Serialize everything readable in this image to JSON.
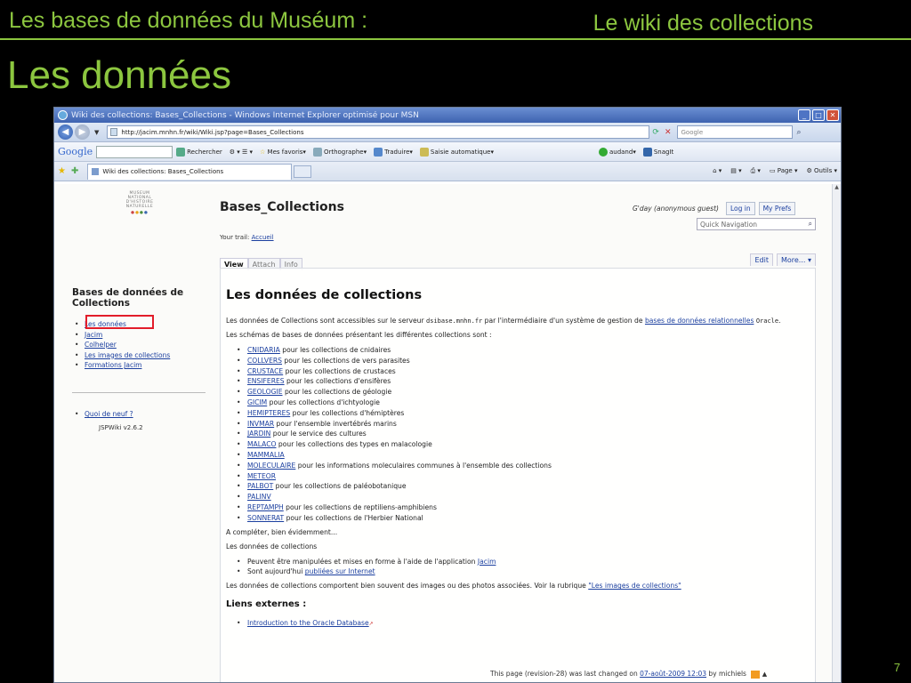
{
  "slide": {
    "header_left": "Les bases de données du Muséum :",
    "header_right": "Le wiki des collections",
    "title": "Les données",
    "page_number": "7"
  },
  "browser": {
    "window_title": "Wiki des collections: Bases_Collections - Windows Internet Explorer optimisé pour MSN",
    "url": "http://jacim.mnhn.fr/wiki/Wiki.jsp?page=Bases_Collections",
    "search_placeholder": "Google",
    "google_toolbar": {
      "logo": "Google",
      "search_btn": "Rechercher",
      "favorites": "Mes favoris",
      "spelling": "Orthographe",
      "translate": "Traduire",
      "autofill": "Saisie automatique",
      "user": "audand",
      "snagit": "SnagIt"
    },
    "tab_label": "Wiki des collections: Bases_Collections",
    "tab_tools": {
      "page": "Page",
      "tools": "Outils"
    }
  },
  "wiki": {
    "logo_lines": [
      "MUSEUM",
      "NATIONAL",
      "D'HISTOIRE",
      "NATURELLE"
    ],
    "page_name": "Bases_Collections",
    "trail_label": "Your trail:",
    "trail_link": "Accueil",
    "user_greeting": "G'day (anonymous guest)",
    "login": "Log in",
    "prefs": "My Prefs",
    "quick_nav": "Quick Navigation",
    "tabs": {
      "view": "View",
      "attach": "Attach",
      "info": "Info",
      "edit": "Edit",
      "more": "More... ▾"
    },
    "sidebar": {
      "title": "Bases de données de Collections",
      "links": [
        "Les données",
        "Jacim",
        "Colhelper",
        "Les images de collections",
        "Formations Jacim"
      ],
      "whats_new": "Quoi de neuf ?",
      "version": "JSPWiki v2.6.2"
    },
    "content": {
      "heading": "Les données de collections",
      "intro_before": "Les données de Collections sont accessibles sur le serveur ",
      "server": "dsibase.mnhn.fr",
      "intro_mid": " par l'intermédiaire d'un système de gestion de ",
      "intro_link": "bases de données relationnelles",
      "intro_oracle": "Oracle",
      "intro_end": ".",
      "schemas_intro": "Les schémas de bases de données présentant les différentes collections sont :",
      "schemas": [
        {
          "name": "CNIDARIA",
          "desc": " pour les collections de cnidaires"
        },
        {
          "name": "COLLVERS",
          "desc": " pour les collections de vers parasites"
        },
        {
          "name": "CRUSTACE",
          "desc": " pour les collections de crustaces"
        },
        {
          "name": "ENSIFERES",
          "desc": " pour les collections d'ensifères"
        },
        {
          "name": "GEOLOGIE",
          "desc": " pour les collections de géologie"
        },
        {
          "name": "GICIM",
          "desc": " pour les collections d'ichtyologie"
        },
        {
          "name": "HEMIPTERES",
          "desc": " pour les collections d'hémiptères"
        },
        {
          "name": "INVMAR",
          "desc": " pour l'ensemble invertébrés marins"
        },
        {
          "name": "JARDIN",
          "desc": " pour le service des cultures"
        },
        {
          "name": "MALACO",
          "desc": " pour les collections des types en malacologie"
        },
        {
          "name": "MAMMALIA",
          "desc": ""
        },
        {
          "name": "MOLECULAIRE",
          "desc": " pour les informations moleculaires communes à l'ensemble des collections"
        },
        {
          "name": "METEOR",
          "desc": ""
        },
        {
          "name": "PALBOT",
          "desc": " pour les collections de paléobotanique"
        },
        {
          "name": "PALINV",
          "desc": ""
        },
        {
          "name": "REPTAMPH",
          "desc": " pour les collections de reptiliens-amphibiens"
        },
        {
          "name": "SONNERAT",
          "desc": " pour les collections de l'Herbier National"
        }
      ],
      "complete_note": "A compléter, bien évidemment...",
      "data_intro": "Les données de collections",
      "bullet1_before": "Peuvent être manipulées et mises en forme à l'aide de l'application ",
      "bullet1_link": "Jacim",
      "bullet2_before": "Sont aujourd'hui ",
      "bullet2_link": "publiées sur Internet",
      "images_before": "Les données de collections comportent bien souvent des images ou des photos associées. Voir la rubrique ",
      "images_link": "\"Les images de collections\"",
      "external_heading": "Liens externes :",
      "external_link": "Introduction to the Oracle Database"
    },
    "footer": {
      "before": "This page (revision-28) was last changed on ",
      "date": "07-août-2009 12:03",
      "by": " by michiels"
    }
  }
}
